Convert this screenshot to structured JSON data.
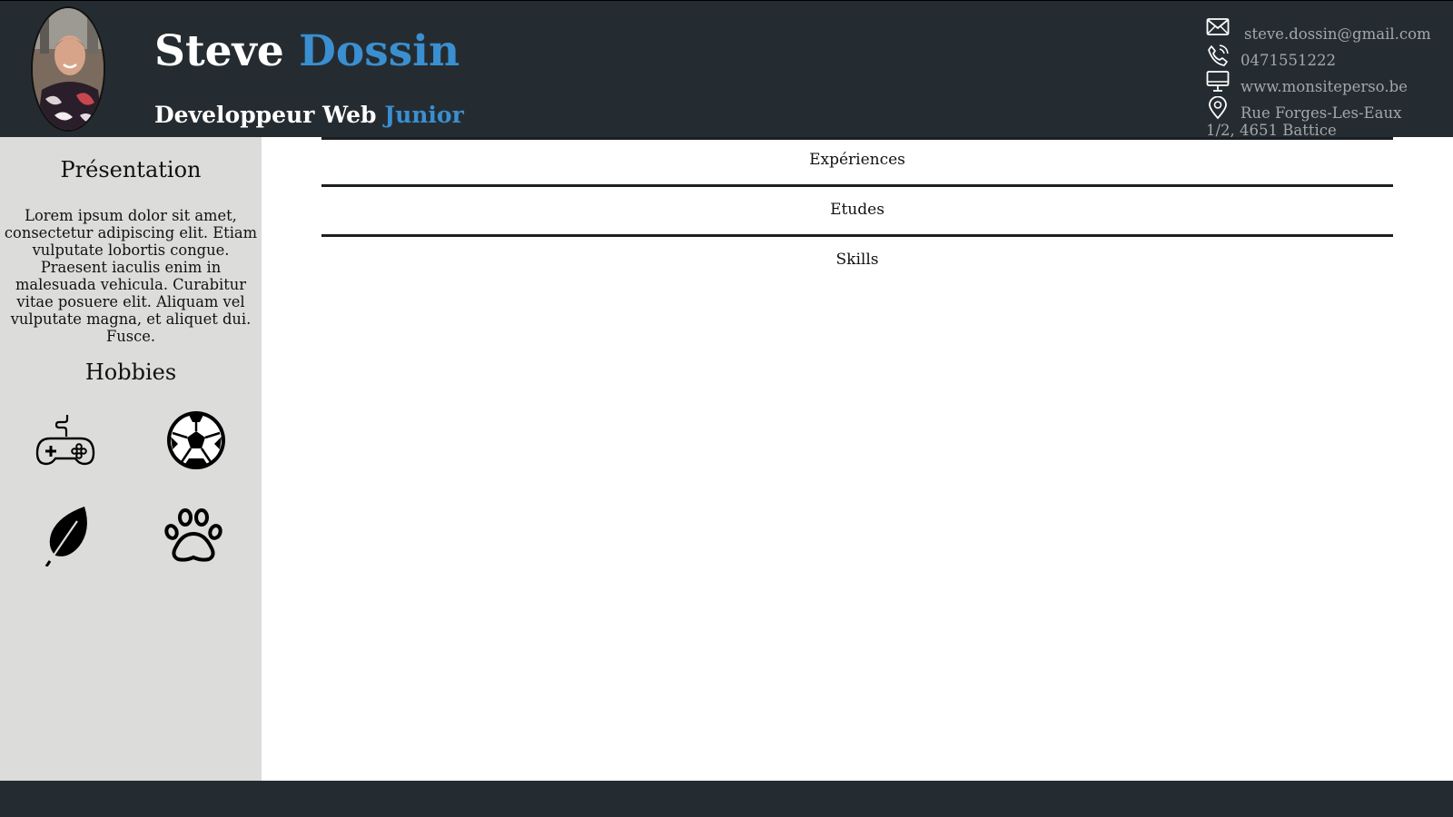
{
  "header": {
    "first_name": "Steve",
    "last_name": "Dossin",
    "role_main": "Developpeur Web",
    "role_accent": "Junior",
    "accent_color": "#3a8fd0",
    "background_color": "#252c31"
  },
  "contacts": {
    "email": "steve.dossin@gmail.com",
    "phone": "0471551222",
    "website": "www.monsiteperso.be",
    "address": "Rue Forges-Les-Eaux 1/2, 4651 Battice",
    "icons": [
      "envelope-icon",
      "phone-icon",
      "monitor-icon",
      "map-pin-icon"
    ]
  },
  "sidebar": {
    "presentation_title": "Présentation",
    "presentation_text": "Lorem ipsum dolor sit amet, consectetur adipiscing elit. Etiam vulputate lobortis congue. Praesent iaculis enim in malesuada vehicula. Curabitur vitae posuere elit. Aliquam vel vulputate magna, et aliquet dui. Fusce.",
    "hobbies_title": "Hobbies",
    "hobbies": [
      "gamepad-icon",
      "soccer-ball-icon",
      "leaf-icon",
      "paw-icon"
    ],
    "background_color": "#dcdcdb"
  },
  "main": {
    "sections": [
      {
        "label": "Expériences"
      },
      {
        "label": "Etudes"
      },
      {
        "label": "Skills"
      }
    ]
  }
}
